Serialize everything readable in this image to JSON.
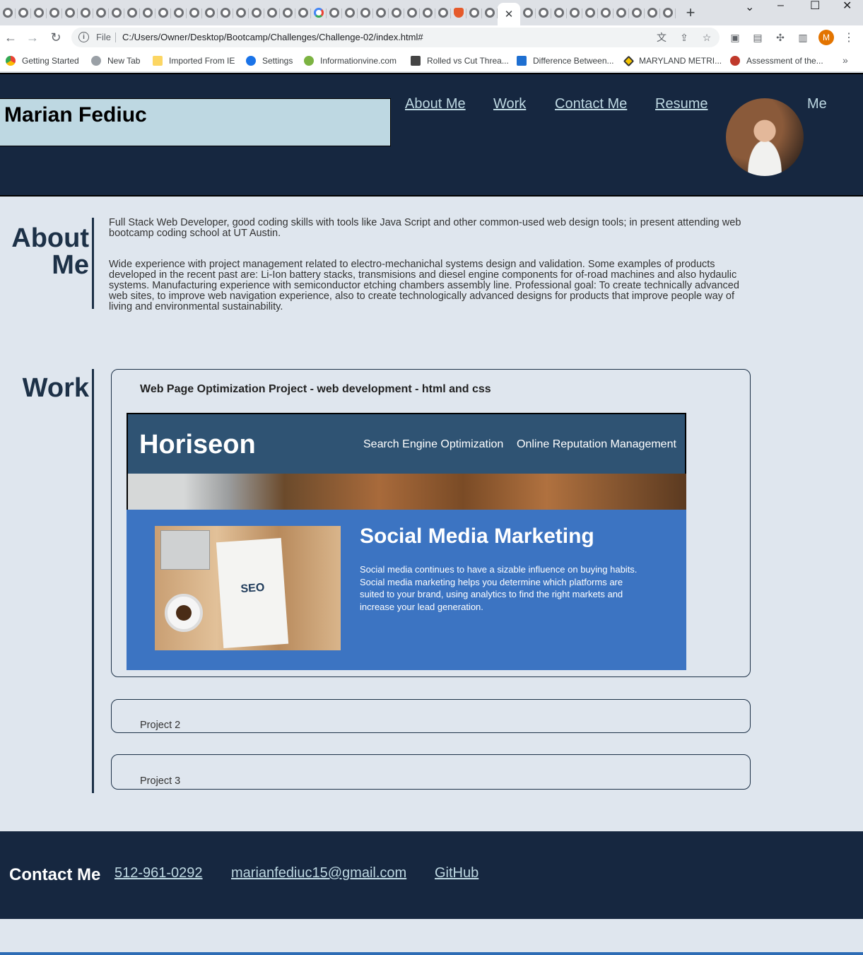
{
  "browser": {
    "tab_count_before_active": 32,
    "tab_count_after_active": 10,
    "google_tab_index": 20,
    "shield_tab_index": 29,
    "close_tab_glyph": "✕",
    "new_tab_glyph": "+",
    "url_scheme": "File",
    "url": "C:/Users/Owner/Desktop/Bootcamp/Challenges/Challenge-02/index.html#",
    "profile_initial": "M",
    "bookmarks": [
      {
        "label": "Getting Started",
        "icon": "chrome-icon"
      },
      {
        "label": "New Tab",
        "icon": "globe-icon"
      },
      {
        "label": "Imported From IE",
        "icon": "folder-icon"
      },
      {
        "label": "Settings",
        "icon": "gear-icon"
      },
      {
        "label": "Informationvine.com",
        "icon": "leaf-icon"
      },
      {
        "label": "Rolled vs Cut Threa...",
        "icon": "bolt-icon"
      },
      {
        "label": "Difference Between...",
        "icon": "triangle-icon"
      },
      {
        "label": "MARYLAND METRI...",
        "icon": "diamond-icon"
      },
      {
        "label": "Assessment of the...",
        "icon": "script-icon"
      }
    ]
  },
  "header": {
    "name": "Marian Fediuc",
    "nav": [
      "About Me",
      "Work",
      "Contact Me",
      "Resume"
    ],
    "me_label": "Me"
  },
  "about": {
    "title_line1": "About",
    "title_line2": "Me",
    "paragraph1_line1": "Full Stack Web Developer, good coding skills with tools like Java Script and other common-used web design tools; in present attending web",
    "paragraph1_line2": "bootcamp coding school at UT Austin.",
    "paragraph2_lines": [
      "Wide experience with project management related to electro-mechanichal systems design and validation. Some examples of products",
      "developed in the recent past are: Li-Ion battery stacks, transmisions and diesel engine components for of-road machines and also hydaulic",
      "systems. Manufacturing experience with semiconductor etching chambers assembly line. Professional goal: To create technically advanced",
      "web sites, to improve web navigation experience, also to create technologically advanced designs for products that improve people way of",
      "living and environmental sustainability."
    ]
  },
  "work": {
    "title": "Work",
    "project1_title": "Web Page Optimization Project - web development - html and css",
    "project1_screenshot": {
      "logo": "Horiseon",
      "nav1": "Search Engine Optimization",
      "nav2": "Online Reputation Management",
      "seo_text": "SEO",
      "heading": "Social Media Marketing",
      "body_lines": [
        "Social media continues to have a sizable influence on buying habits.",
        "Social media marketing helps you determine which platforms are",
        "suited to your brand, using analytics to find the right markets and",
        "increase your lead generation."
      ]
    },
    "project2_label": "Project 2",
    "project3_label": "Project 3"
  },
  "footer": {
    "title": "Contact Me",
    "phone": "512-961-0292",
    "email": "marianfediuc15@gmail.com",
    "github": "GitHub"
  },
  "colors": {
    "header_bg": "#162740",
    "name_box_bg": "#bed8e2",
    "page_bg": "#dfe6ee",
    "accent_dark": "#1d3147",
    "link": "#bed8e2"
  }
}
